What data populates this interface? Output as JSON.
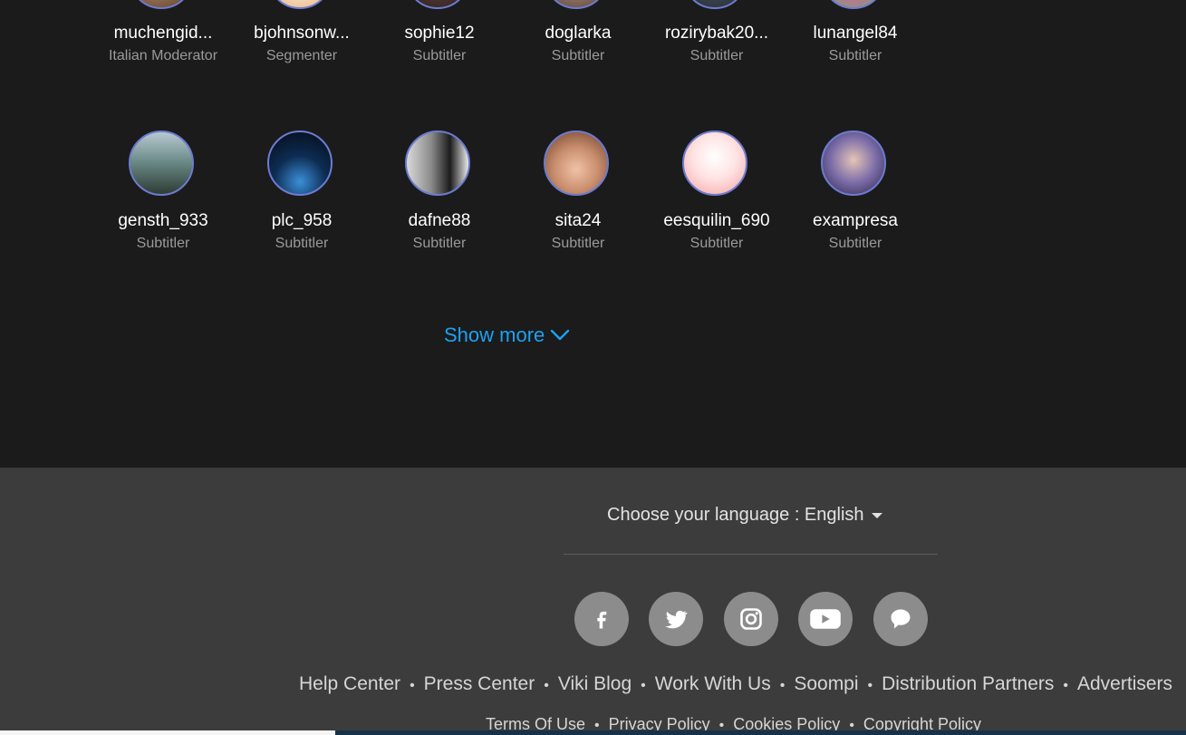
{
  "members_row1": [
    {
      "name": "muchengid...",
      "role": "Italian Moderator"
    },
    {
      "name": "bjohnsonw...",
      "role": "Segmenter"
    },
    {
      "name": "sophie12",
      "role": "Subtitler"
    },
    {
      "name": "doglarka",
      "role": "Subtitler"
    },
    {
      "name": "rozirybak20...",
      "role": "Subtitler"
    },
    {
      "name": "lunangel84",
      "role": "Subtitler"
    }
  ],
  "members_row2": [
    {
      "name": "gensth_933",
      "role": "Subtitler"
    },
    {
      "name": "plc_958",
      "role": "Subtitler"
    },
    {
      "name": "dafne88",
      "role": "Subtitler"
    },
    {
      "name": "sita24",
      "role": "Subtitler"
    },
    {
      "name": "eesquilin_690",
      "role": "Subtitler"
    },
    {
      "name": "exampresa",
      "role": "Subtitler"
    }
  ],
  "show_more": "Show more",
  "footer": {
    "language_label": "Choose your language : English",
    "social_icons": [
      "facebook-icon",
      "twitter-icon",
      "instagram-icon",
      "youtube-icon",
      "chat-icon"
    ],
    "links_primary": [
      "Help Center",
      "Press Center",
      "Viki Blog",
      "Work With Us",
      "Soompi",
      "Distribution Partners",
      "Advertisers"
    ],
    "links_secondary": [
      "Terms Of Use",
      "Privacy Policy",
      "Cookies Policy",
      "Copyright Policy"
    ]
  },
  "colors": {
    "accent": "#1da1f2",
    "background": "#1b1b1c",
    "footer": "#3c3c3c",
    "avatar_ring": "#6d7bd0"
  }
}
